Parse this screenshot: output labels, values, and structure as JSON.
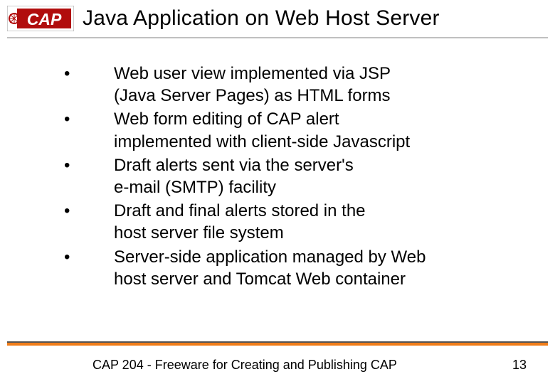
{
  "logo": {
    "text": "CAP",
    "bg": "#b10d0d",
    "fg": "#ffffff"
  },
  "title": "Java Application on Web Host Server",
  "bullets": [
    "Web user view implemented via JSP\n(Java Server Pages) as HTML forms",
    "Web form editing of CAP alert\nimplemented with client-side Javascript",
    "Draft alerts sent via the server's\ne-mail (SMTP) facility",
    "Draft and final alerts stored in the\nhost server file system",
    "Server-side application managed by Web\nhost server and Tomcat Web container"
  ],
  "footer": {
    "text": "CAP 204 - Freeware for Creating and Publishing CAP",
    "page": "13"
  }
}
